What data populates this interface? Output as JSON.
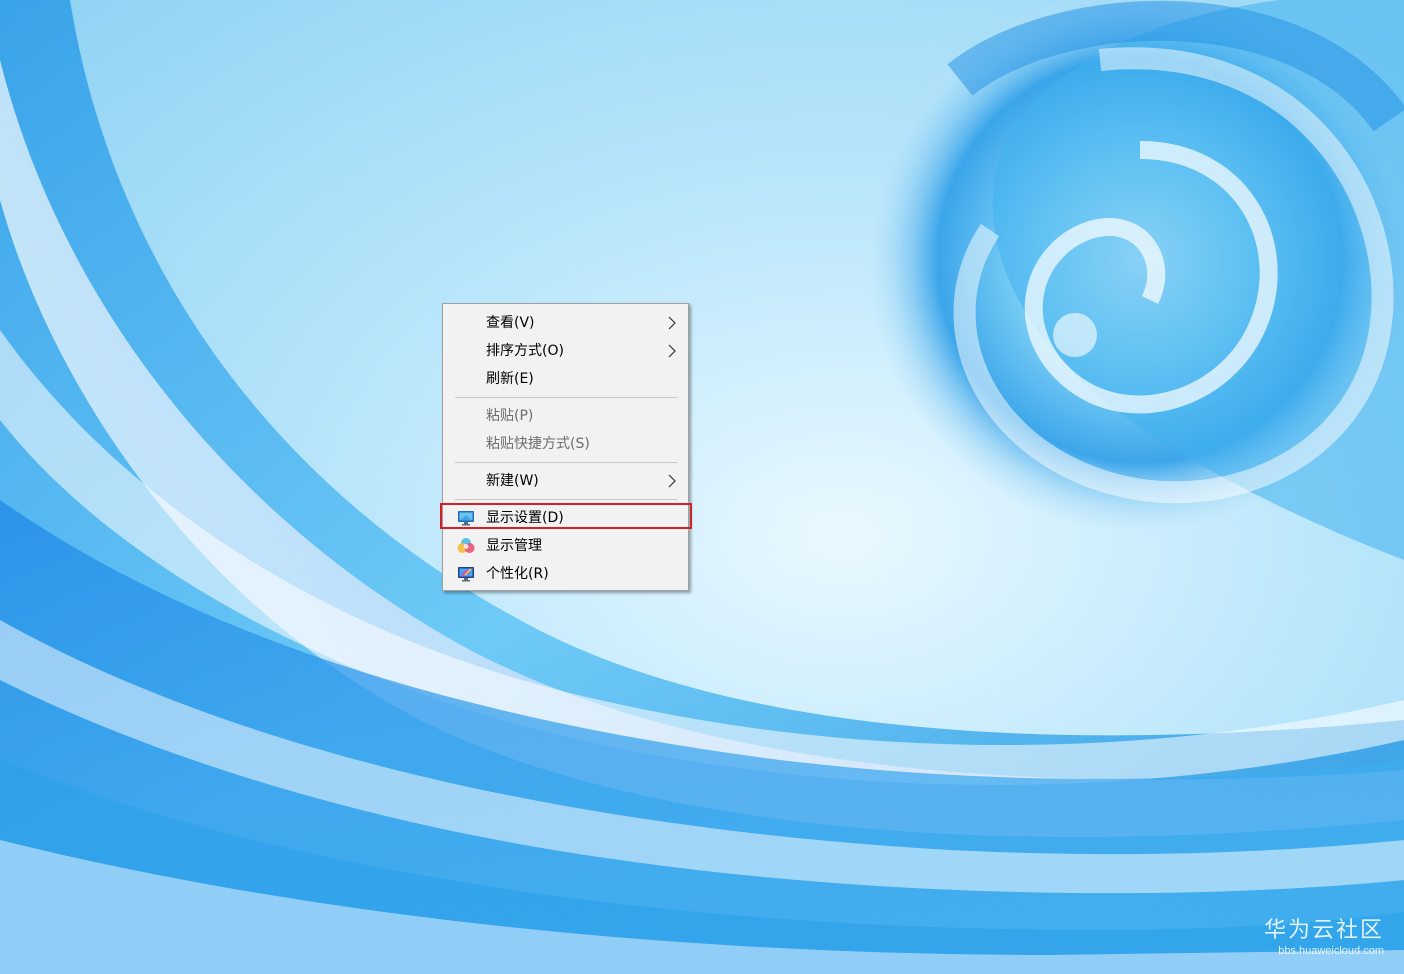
{
  "context_menu": {
    "items": [
      {
        "label": "查看(V)",
        "has_submenu": true,
        "enabled": true
      },
      {
        "label": "排序方式(O)",
        "has_submenu": true,
        "enabled": true
      },
      {
        "label": "刷新(E)",
        "has_submenu": false,
        "enabled": true
      },
      {
        "label": "粘贴(P)",
        "has_submenu": false,
        "enabled": false
      },
      {
        "label": "粘贴快捷方式(S)",
        "has_submenu": false,
        "enabled": false
      },
      {
        "label": "新建(W)",
        "has_submenu": true,
        "enabled": true
      },
      {
        "label": "显示设置(D)",
        "icon": "display-settings-icon",
        "enabled": true,
        "highlighted": true
      },
      {
        "label": "显示管理",
        "icon": "display-management-icon",
        "enabled": true
      },
      {
        "label": "个性化(R)",
        "icon": "personalize-icon",
        "enabled": true
      }
    ],
    "highlight_color": "#d0202a"
  },
  "watermark": {
    "title": "华为云社区",
    "url": "bbs.huaweicloud.com"
  }
}
